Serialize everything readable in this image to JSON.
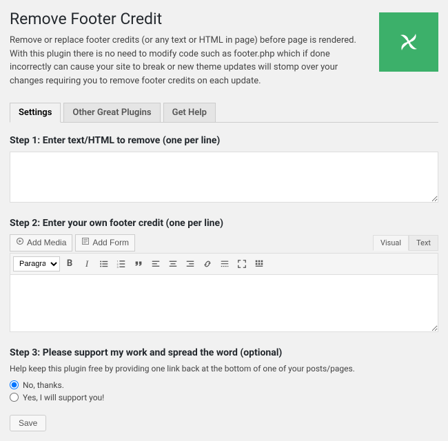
{
  "header": {
    "title": "Remove Footer Credit",
    "description": "Remove or replace footer credits (or any text or HTML in page) before page is rendered. With this plugin there is no need to modify code such as footer.php which if done incorrectly can cause your site to break or new theme updates will stomp over your changes requiring you to remove footer credits on each update."
  },
  "tabs": {
    "settings": "Settings",
    "other": "Other Great Plugins",
    "help": "Get Help"
  },
  "step1": {
    "heading": "Step 1: Enter text/HTML to remove (one per line)",
    "value": ""
  },
  "step2": {
    "heading": "Step 2: Enter your own footer credit (one per line)",
    "add_media": "Add Media",
    "add_form": "Add Form",
    "visual_tab": "Visual",
    "text_tab": "Text",
    "paragraph": "Paragraph",
    "value": ""
  },
  "step3": {
    "heading": "Step 3: Please support my work and spread the word (optional)",
    "support_text": "Help keep this plugin free by providing one link back at the bottom of one of your posts/pages.",
    "no_label": "No, thanks.",
    "yes_label": "Yes, I will support you!"
  },
  "save_label": "Save"
}
